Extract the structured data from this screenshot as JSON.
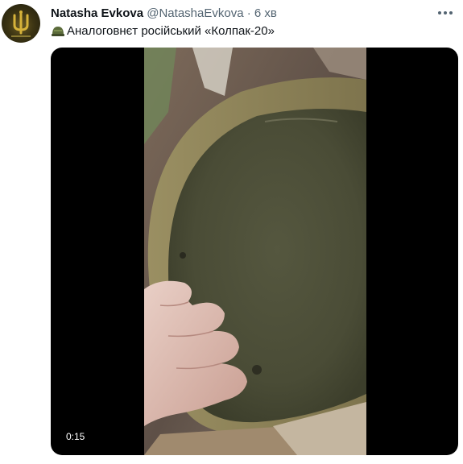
{
  "tweet": {
    "author_name": "Natasha Evkova",
    "author_handle": "@NatashaEvkova",
    "separator": "·",
    "time": "6 хв",
    "text": "Аналоговнєт російський «Колпак-20»",
    "text_emoji": "helmet-icon"
  },
  "media": {
    "type": "video",
    "duration": "0:15"
  },
  "colors": {
    "name": "#0f1419",
    "secondary": "#536471",
    "media_background": "#000000"
  }
}
